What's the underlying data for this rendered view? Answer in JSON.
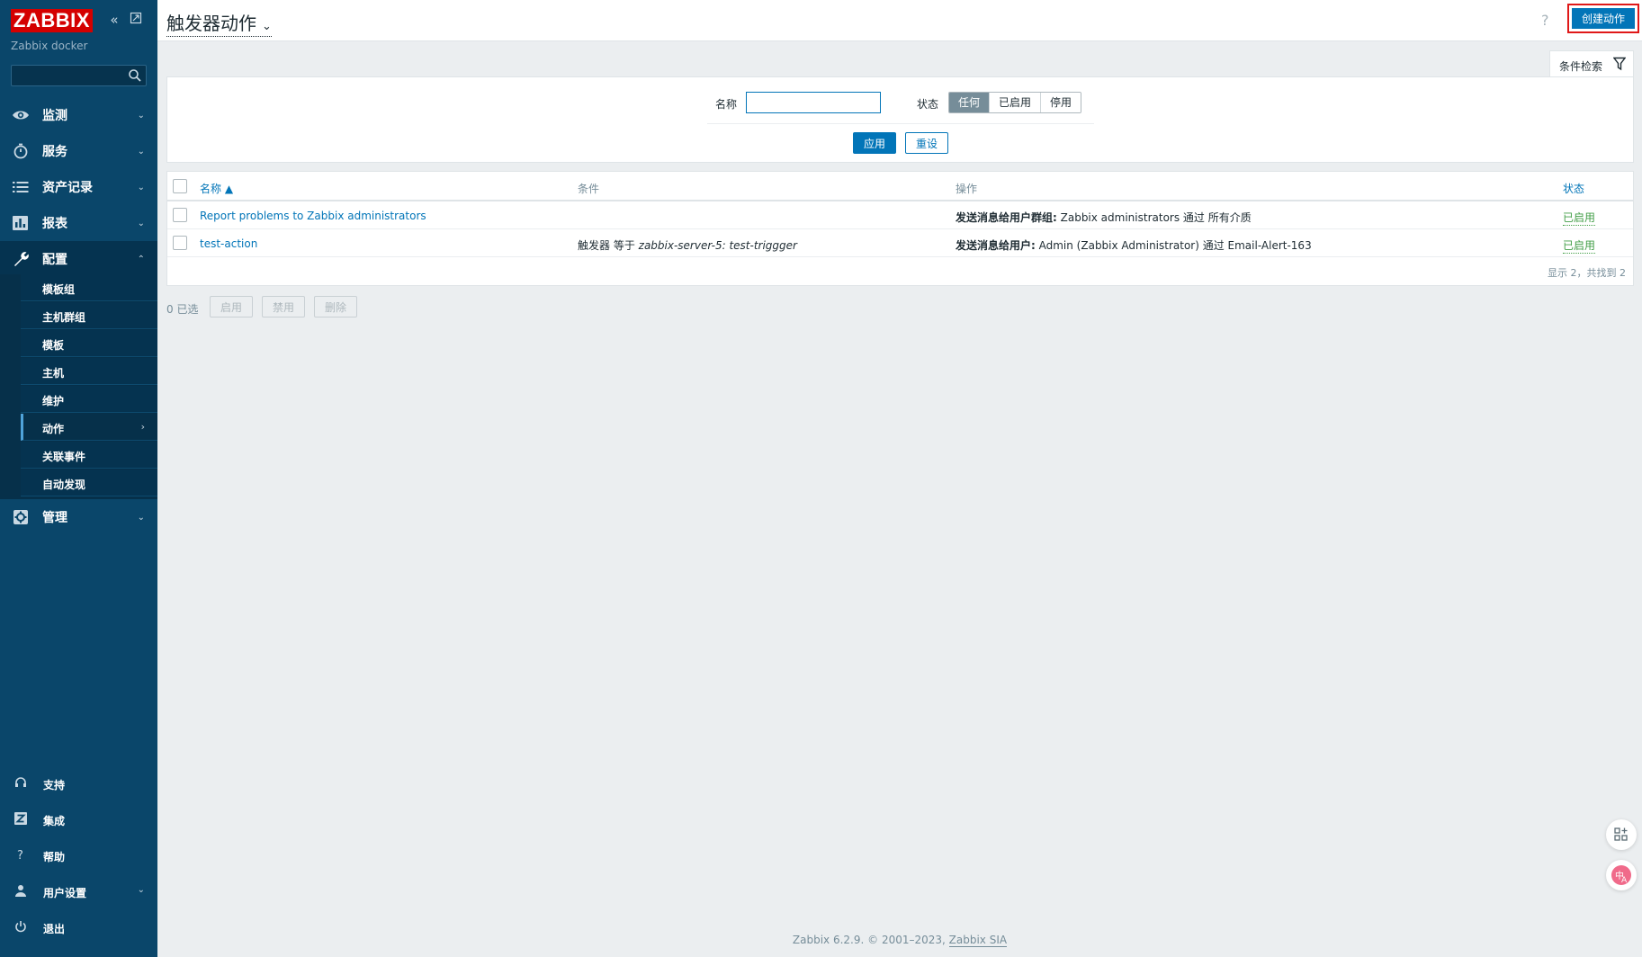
{
  "sidebar": {
    "logo": "ZABBIX",
    "server_name": "Zabbix docker",
    "search": {
      "value": "",
      "placeholder": ""
    },
    "menu": [
      {
        "label": "监测",
        "icon": "eye-icon",
        "chevron": "⌄"
      },
      {
        "label": "服务",
        "icon": "stopwatch-icon",
        "chevron": "⌄"
      },
      {
        "label": "资产记录",
        "icon": "list-icon",
        "chevron": "⌄"
      },
      {
        "label": "报表",
        "icon": "bar-chart-icon",
        "chevron": "⌄"
      },
      {
        "label": "配置",
        "icon": "wrench-icon",
        "chevron": "⌃"
      },
      {
        "label": "管理",
        "icon": "gear-icon",
        "chevron": "⌄"
      }
    ],
    "submenu": [
      "模板组",
      "主机群组",
      "模板",
      "主机",
      "维护",
      "动作",
      "关联事件",
      "自动发现"
    ],
    "active_sub_chevron": "›",
    "bottom": [
      {
        "label": "支持",
        "icon": "headset-icon"
      },
      {
        "label": "集成",
        "icon": "zabbix-z-icon"
      },
      {
        "label": "帮助",
        "icon": "question-icon"
      },
      {
        "label": "用户设置",
        "icon": "user-icon",
        "chevron": "⌄"
      },
      {
        "label": "退出",
        "icon": "power-icon"
      }
    ]
  },
  "header": {
    "title": "触发器动作",
    "title_chevron": "⌄",
    "help": "?",
    "create_button": "创建动作"
  },
  "filter": {
    "tab_label": "条件检索",
    "name_label": "名称",
    "name_value": "",
    "status_label": "状态",
    "status_options": [
      "任何",
      "已启用",
      "停用"
    ],
    "status_selected": "任何",
    "apply": "应用",
    "reset": "重设"
  },
  "table": {
    "columns": [
      "名称 ▲",
      "条件",
      "操作",
      "状态"
    ],
    "rows": [
      {
        "name": "Report problems to Zabbix administrators",
        "condition_prefix": "",
        "condition_host": "",
        "condition_sep": "",
        "condition_trigger": "",
        "op_bold": "发送消息给用户群组:",
        "op_text": " Zabbix administrators 通过 所有介质",
        "status": "已启用"
      },
      {
        "name": "test-action",
        "condition_prefix": "触发器 等于 ",
        "condition_host": "zabbix-server-5",
        "condition_sep": ": ",
        "condition_trigger": "test-triggger",
        "op_bold": "发送消息给用户:",
        "op_text": " Admin (Zabbix Administrator) 通过 Email-Alert-163",
        "status": "已启用"
      }
    ],
    "footer": "显示 2，共找到 2"
  },
  "mass_actions": {
    "selected": "0 已选",
    "enable": "启用",
    "disable": "禁用",
    "delete": "删除"
  },
  "footer": {
    "text": "Zabbix 6.2.9. © 2001–2023, ",
    "link": "Zabbix SIA"
  },
  "floating": [
    "apps-plus-icon",
    "translate-icon"
  ]
}
